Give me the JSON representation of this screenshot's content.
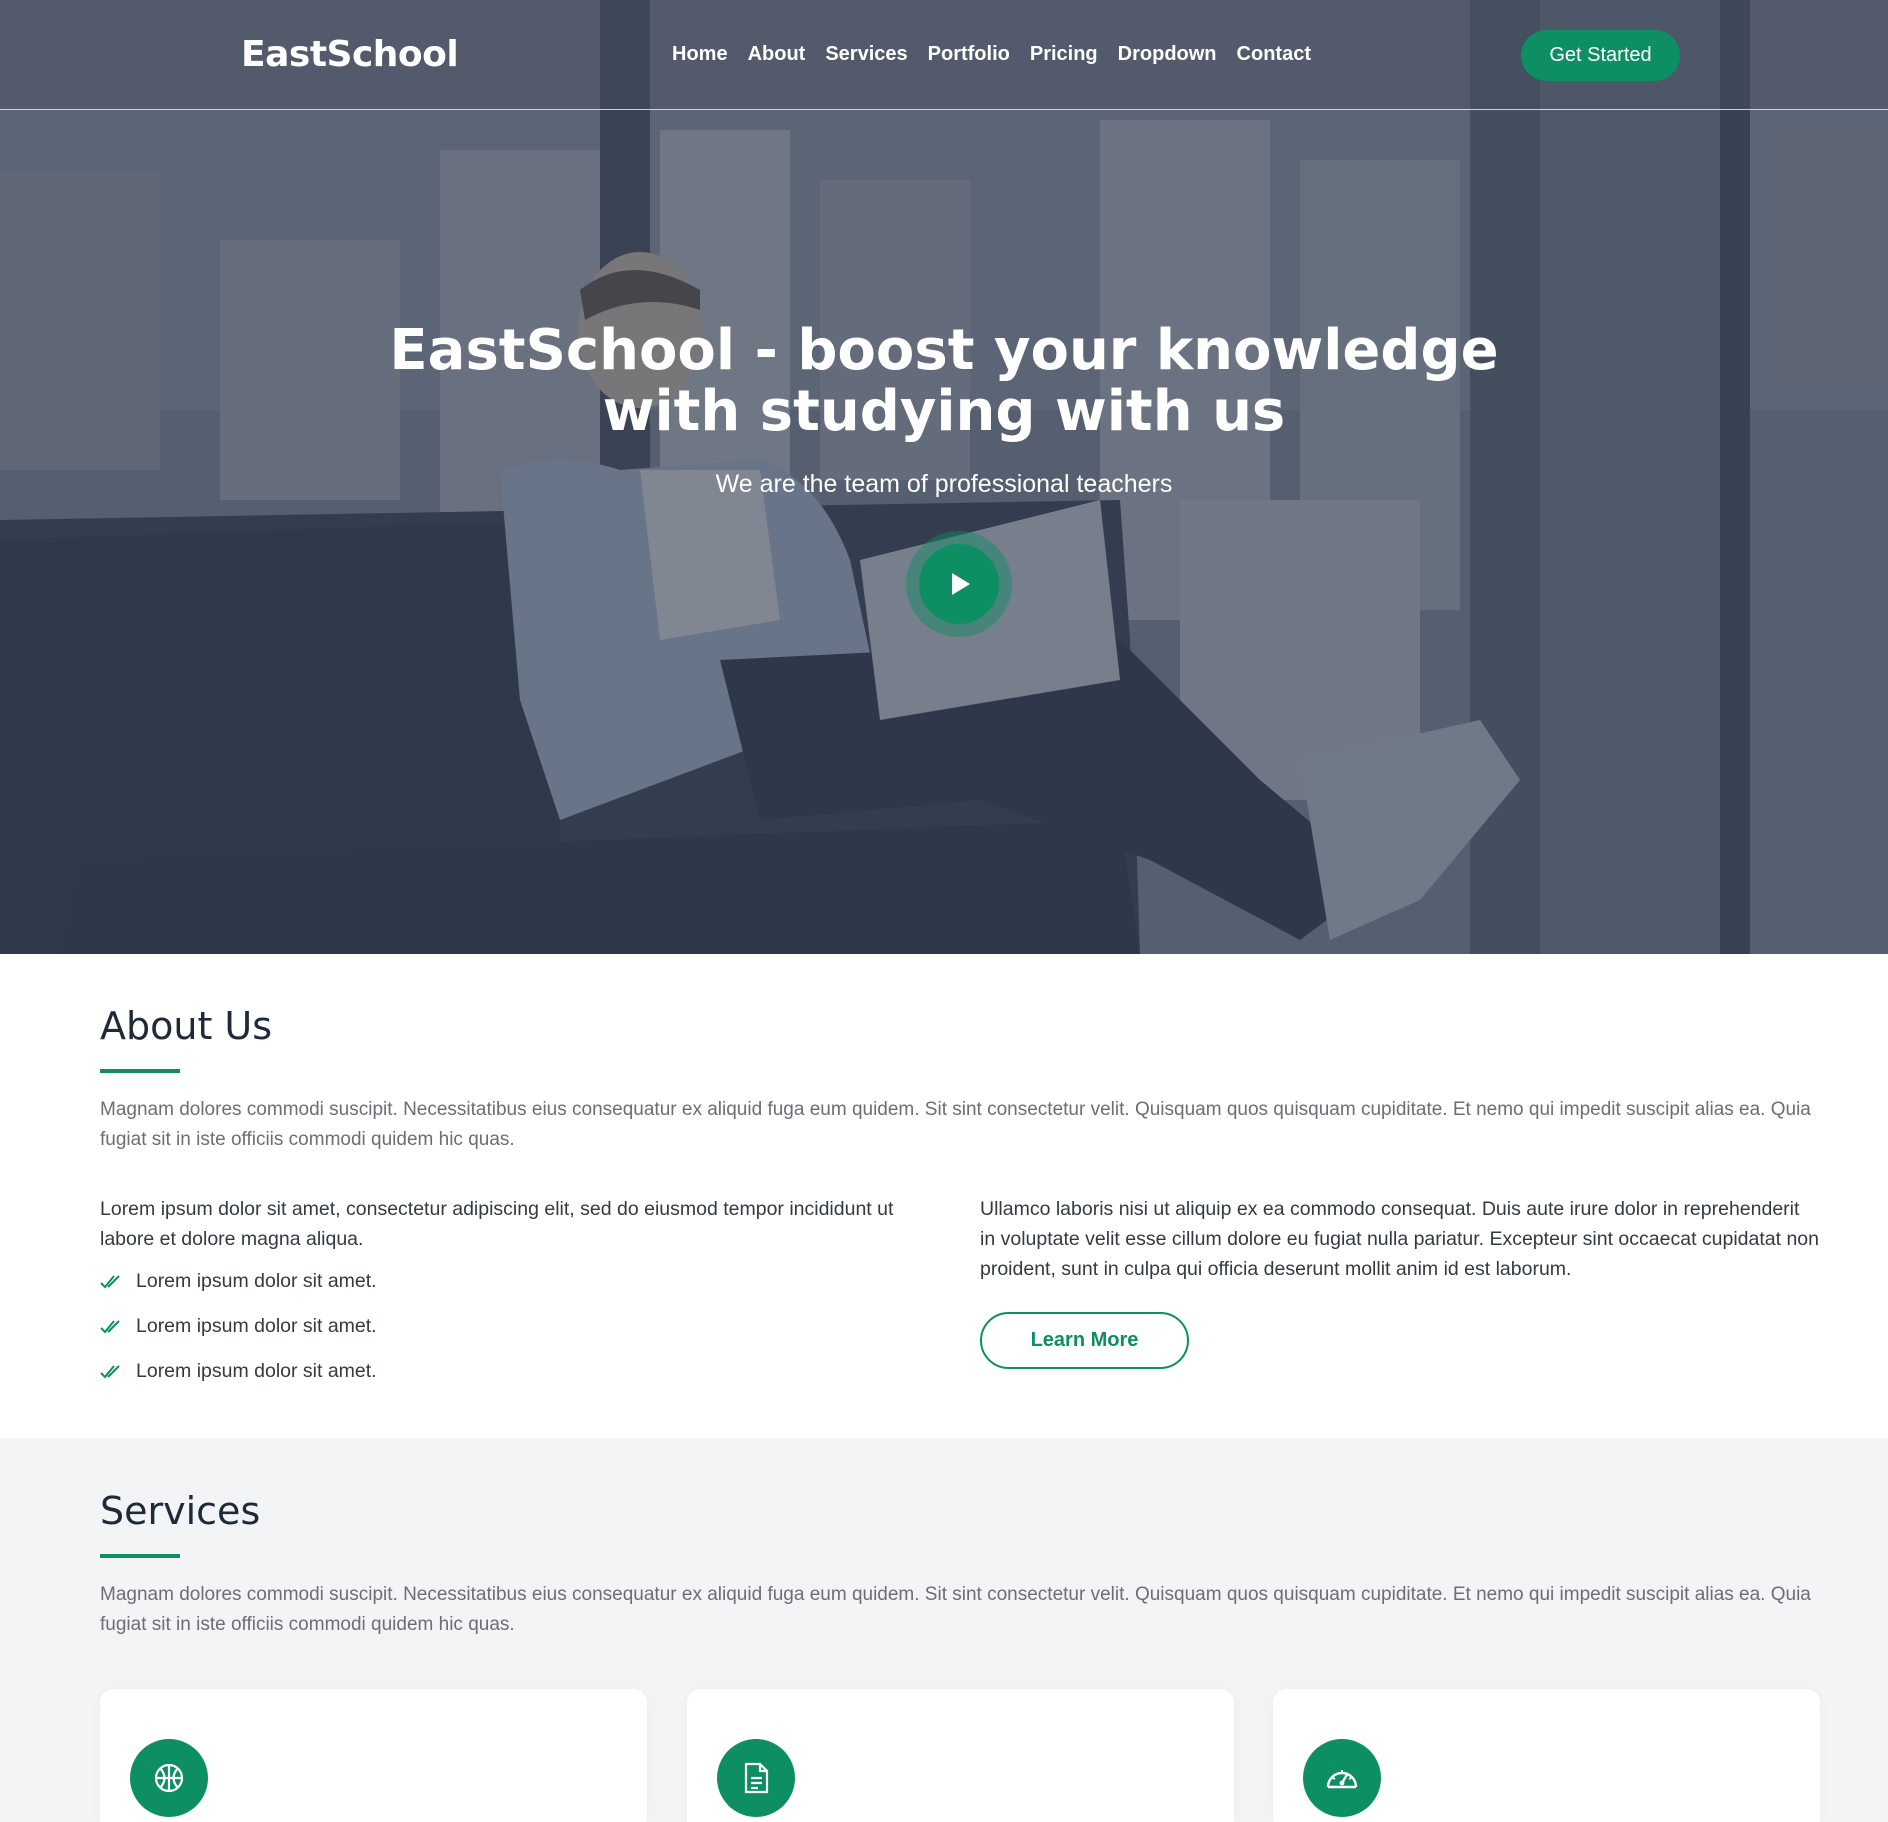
{
  "brand": {
    "logo": "EastSchool",
    "accent": "#0d8f63"
  },
  "nav": {
    "items": [
      "Home",
      "About",
      "Services",
      "Portfolio",
      "Pricing",
      "Dropdown",
      "Contact"
    ],
    "cta": "Get Started"
  },
  "hero": {
    "title_line1": "EastSchool - boost your knowledge",
    "title_line2": "with studying with us",
    "subtitle": "We are the team of professional teachers",
    "play_icon": "play-icon"
  },
  "about": {
    "title": "About Us",
    "lead": "Magnam dolores commodi suscipit. Necessitatibus eius consequatur ex aliquid fuga eum quidem. Sit sint consectetur velit. Quisquam quos quisquam cupiditate. Et nemo qui impedit suscipit alias ea. Quia fugiat sit in iste officiis commodi quidem hic quas.",
    "left_text": "Lorem ipsum dolor sit amet, consectetur adipiscing elit, sed do eiusmod tempor incididunt ut labore et dolore magna aliqua.",
    "checklist": [
      "Lorem ipsum dolor sit amet.",
      "Lorem ipsum dolor sit amet.",
      "Lorem ipsum dolor sit amet."
    ],
    "right_text": "Ullamco laboris nisi ut aliquip ex ea commodo consequat. Duis aute irure dolor in reprehenderit in voluptate velit esse cillum dolore eu fugiat nulla pariatur. Excepteur sint occaecat cupidatat non proident, sunt in culpa qui officia deserunt mollit anim id est laborum.",
    "button": "Learn More"
  },
  "services": {
    "title": "Services",
    "lead": "Magnam dolores commodi suscipit. Necessitatibus eius consequatur ex aliquid fuga eum quidem. Sit sint consectetur velit. Quisquam quos quisquam cupiditate. Et nemo qui impedit suscipit alias ea. Quia fugiat sit in iste officiis commodi quidem hic quas.",
    "cards": [
      {
        "icon": "basketball-icon"
      },
      {
        "icon": "document-icon"
      },
      {
        "icon": "speedometer-icon"
      }
    ]
  }
}
